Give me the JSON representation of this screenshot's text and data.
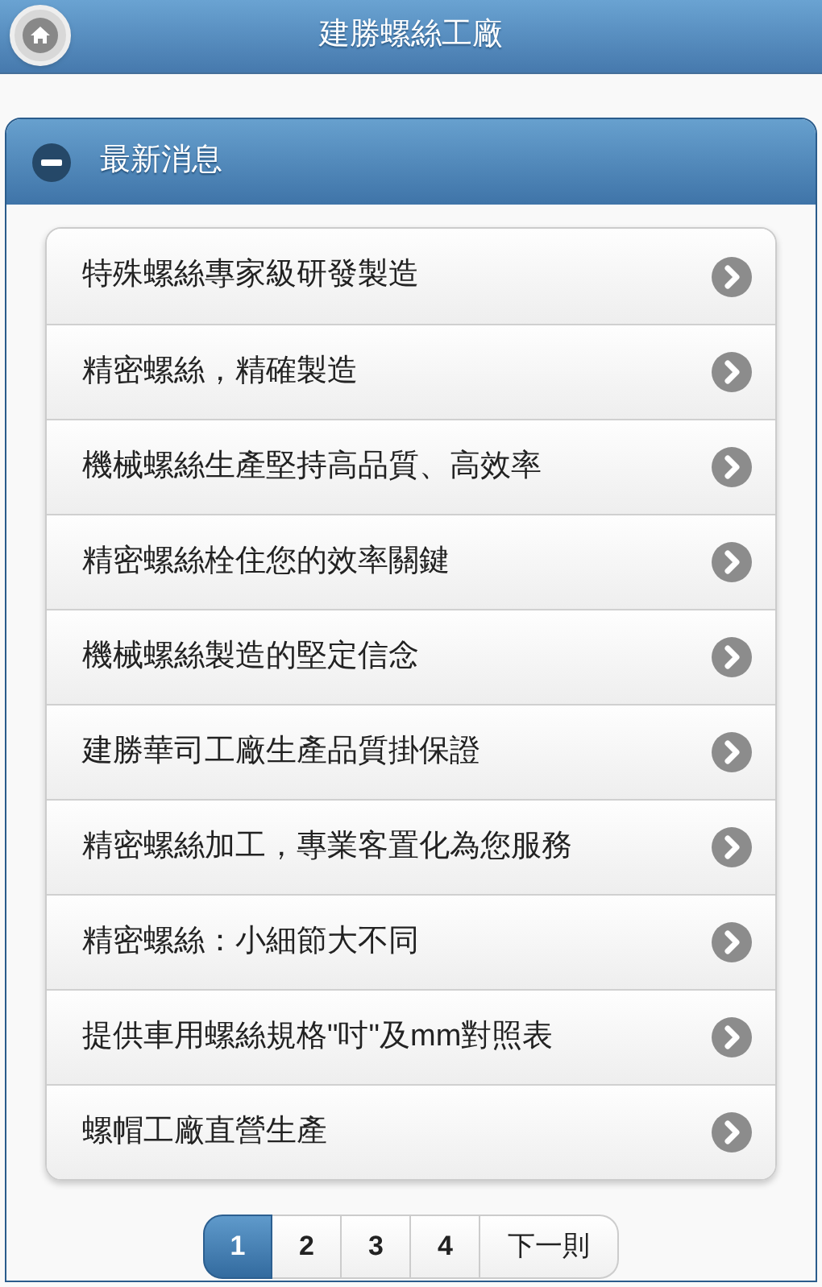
{
  "header": {
    "title": "建勝螺絲工廠"
  },
  "section": {
    "title": "最新消息",
    "expanded": true,
    "items": [
      {
        "label": "特殊螺絲專家級研發製造"
      },
      {
        "label": "精密螺絲，精確製造"
      },
      {
        "label": "機械螺絲生產堅持高品質、高效率"
      },
      {
        "label": "精密螺絲栓住您的效率關鍵"
      },
      {
        "label": "機械螺絲製造的堅定信念"
      },
      {
        "label": "建勝華司工廠生產品質掛保證"
      },
      {
        "label": "精密螺絲加工，專業客置化為您服務"
      },
      {
        "label": "精密螺絲：小細節大不同"
      },
      {
        "label": "提供車用螺絲規格\"吋\"及mm對照表"
      },
      {
        "label": "螺帽工廠直營生產"
      }
    ]
  },
  "pagination": [
    {
      "label": "1",
      "selected": true
    },
    {
      "label": "2",
      "selected": false
    },
    {
      "label": "3",
      "selected": false
    },
    {
      "label": "4",
      "selected": false
    },
    {
      "label": "下一則",
      "selected": false
    }
  ]
}
